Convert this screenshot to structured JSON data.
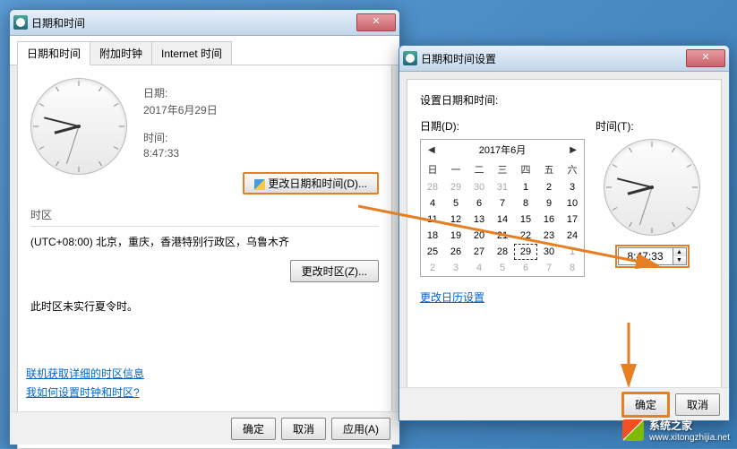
{
  "main": {
    "title": "日期和时间",
    "tabs": [
      "日期和时间",
      "附加时钟",
      "Internet 时间"
    ],
    "date_label": "日期:",
    "date_value": "2017年6月29日",
    "time_label": "时间:",
    "time_value": "8:47:33",
    "change_dt_btn": "更改日期和时间(D)...",
    "tz_label": "时区",
    "tz_value": "(UTC+08:00) 北京，重庆，香港特别行政区，乌鲁木齐",
    "change_tz_btn": "更改时区(Z)...",
    "dst_note": "此时区未实行夏令时。",
    "link1": "联机获取详细的时区信息",
    "link2": "我如何设置时钟和时区?",
    "ok": "确定",
    "cancel": "取消",
    "apply": "应用(A)"
  },
  "settings": {
    "title": "日期和时间设置",
    "prompt": "设置日期和时间:",
    "date_label": "日期(D):",
    "time_label": "时间(T):",
    "month": "2017年6月",
    "dow": [
      "日",
      "一",
      "二",
      "三",
      "四",
      "五",
      "六"
    ],
    "weeks": [
      [
        {
          "d": 28,
          "o": 1
        },
        {
          "d": 29,
          "o": 1
        },
        {
          "d": 30,
          "o": 1
        },
        {
          "d": 31,
          "o": 1
        },
        {
          "d": 1
        },
        {
          "d": 2
        },
        {
          "d": 3
        }
      ],
      [
        {
          "d": 4
        },
        {
          "d": 5
        },
        {
          "d": 6
        },
        {
          "d": 7
        },
        {
          "d": 8
        },
        {
          "d": 9
        },
        {
          "d": 10
        }
      ],
      [
        {
          "d": 11
        },
        {
          "d": 12
        },
        {
          "d": 13
        },
        {
          "d": 14
        },
        {
          "d": 15
        },
        {
          "d": 16
        },
        {
          "d": 17
        }
      ],
      [
        {
          "d": 18
        },
        {
          "d": 19
        },
        {
          "d": 20
        },
        {
          "d": 21
        },
        {
          "d": 22
        },
        {
          "d": 23
        },
        {
          "d": 24
        }
      ],
      [
        {
          "d": 25
        },
        {
          "d": 26
        },
        {
          "d": 27
        },
        {
          "d": 28
        },
        {
          "d": 29,
          "s": 1
        },
        {
          "d": 30
        },
        {
          "d": 1,
          "o": 1
        }
      ],
      [
        {
          "d": 2,
          "o": 1
        },
        {
          "d": 3,
          "o": 1
        },
        {
          "d": 4,
          "o": 1
        },
        {
          "d": 5,
          "o": 1
        },
        {
          "d": 6,
          "o": 1
        },
        {
          "d": 7,
          "o": 1
        },
        {
          "d": 8,
          "o": 1
        }
      ]
    ],
    "time_value": "8:47:33",
    "cal_link": "更改日历设置",
    "ok": "确定",
    "cancel": "取消"
  },
  "watermark": {
    "text": "系统之家",
    "url": "www.xitongzhijia.net"
  }
}
